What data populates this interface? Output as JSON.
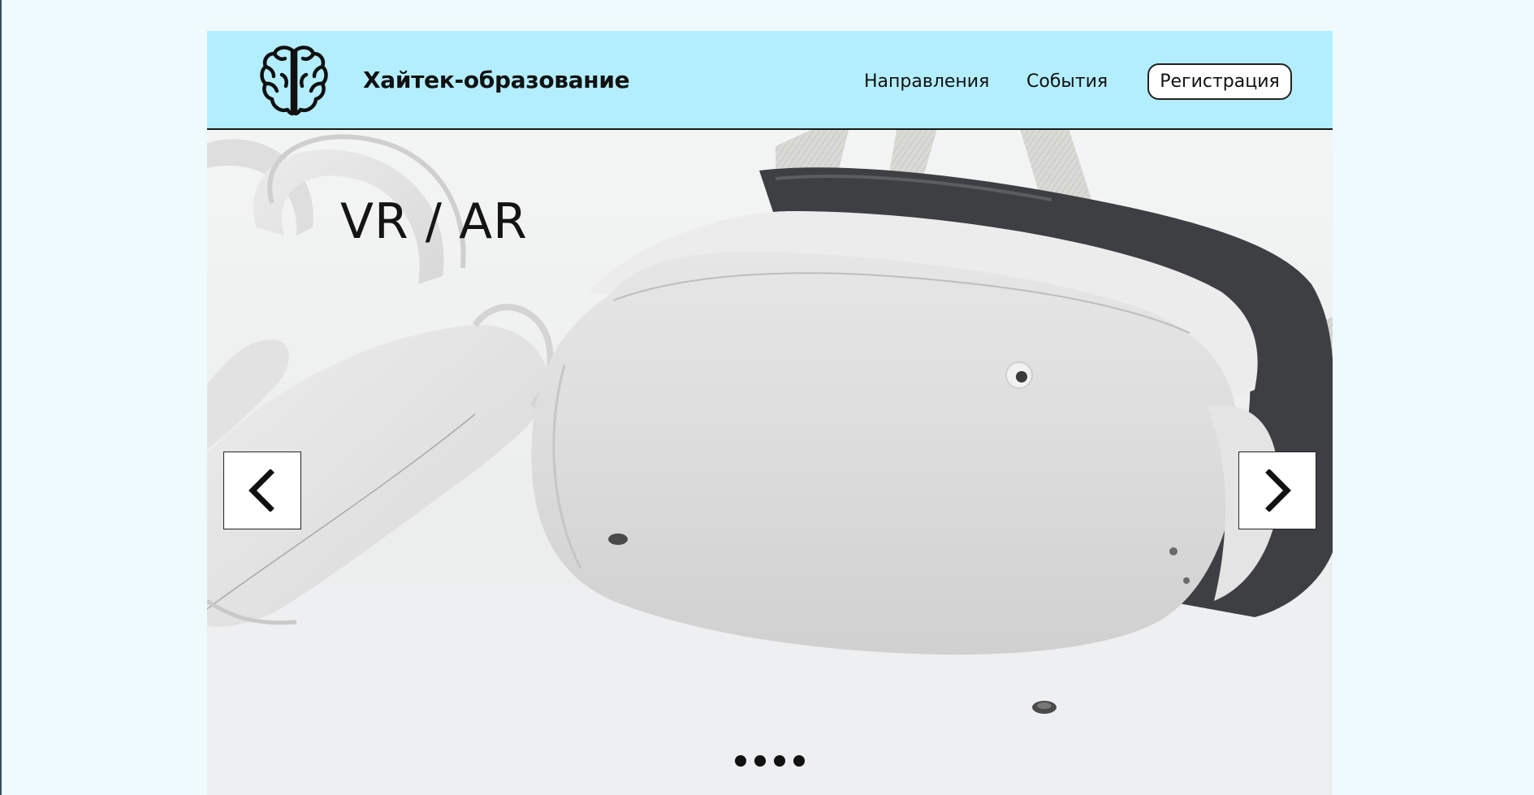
{
  "header": {
    "logo_icon": "brain-icon",
    "logo_text": "Хайтек-образование",
    "nav": [
      {
        "label": "Направления"
      },
      {
        "label": "События"
      }
    ],
    "register_label": "Регистрация"
  },
  "hero": {
    "title": "VR / AR",
    "prev_icon": "chevron-left-icon",
    "next_icon": "chevron-right-icon",
    "slide_count": 4
  },
  "colors": {
    "header_bg": "#b3eeff",
    "page_bg": "#eefafe",
    "text": "#111111"
  }
}
